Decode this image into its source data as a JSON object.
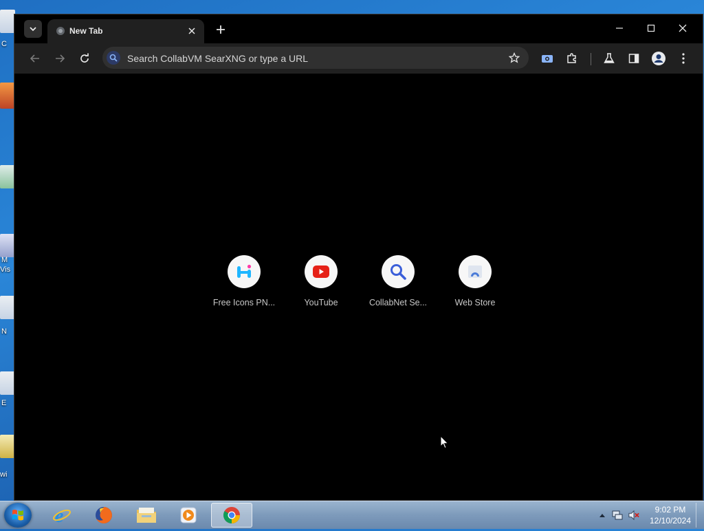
{
  "desktop": {
    "partial_labels": [
      "C",
      "M",
      "Vis",
      "N",
      "E",
      "wi"
    ]
  },
  "browser": {
    "tab": {
      "title": "New Tab"
    },
    "omnibox": {
      "placeholder": "Search CollabVM SearXNG or type a URL"
    },
    "shortcuts": [
      {
        "label": "Free Icons PN...",
        "icon": "free-icons-icon"
      },
      {
        "label": "YouTube",
        "icon": "youtube-icon"
      },
      {
        "label": "CollabNet Se...",
        "icon": "search-icon"
      },
      {
        "label": "Web Store",
        "icon": "web-store-icon"
      }
    ]
  },
  "taskbar": {
    "apps": [
      "internet-explorer-icon",
      "firefox-icon",
      "file-explorer-icon",
      "media-player-icon",
      "chrome-icon"
    ],
    "clock": {
      "time": "9:02 PM",
      "date": "12/10/2024"
    }
  },
  "colors": {
    "accent": "#8ab4f8",
    "youtube_red": "#e62117",
    "free_icons_cyan": "#1fb6ff",
    "free_icons_pink": "#ff3aa7"
  }
}
